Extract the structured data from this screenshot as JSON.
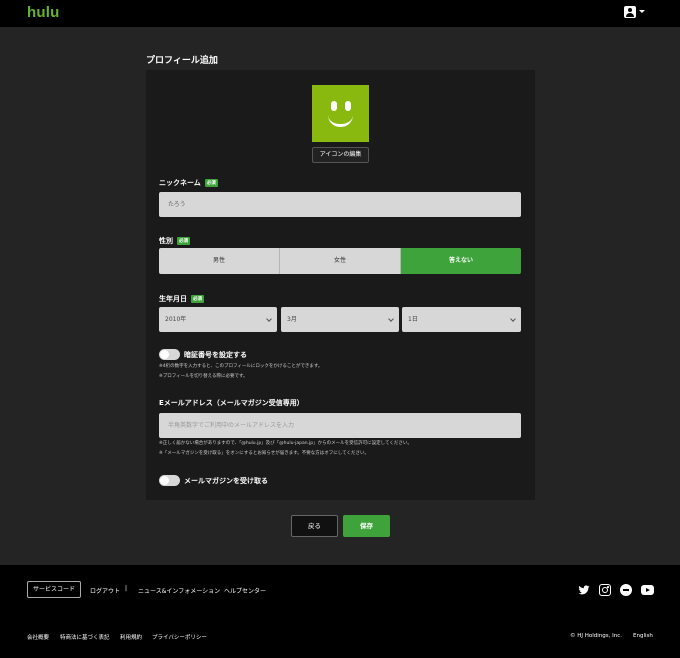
{
  "header": {
    "logo": "hulu"
  },
  "page": {
    "title": "プロフィール追加"
  },
  "avatar": {
    "edit_label": "アイコンの編集",
    "color": "#89b90f"
  },
  "required_badge": "必須",
  "nickname": {
    "label": "ニックネーム",
    "value": "たろう"
  },
  "gender": {
    "label": "性別",
    "options": [
      "男性",
      "女性",
      "答えない"
    ],
    "selected": "答えない"
  },
  "birthday": {
    "label": "生年月日",
    "year": "2010年",
    "month": "3月",
    "day": "1日"
  },
  "pin": {
    "label": "暗証番号を設定する",
    "note1": "※4桁の数字を入力すると、このプロフィールにロックをかけることができます。",
    "note2": "※プロフィールを切り替える際に必要です。"
  },
  "email": {
    "label": "Eメールアドレス（メールマガジン受信専用）",
    "placeholder": "半角英数字でご利用中のメールアドレスを入力",
    "note1": "※正しく届かない場合がありますので、「@hulu.jp」及び「@hulu-japan.jp」からのメールを受信許可に設定してください。",
    "note2": "※「メールマガジンを受け取る」をオンにするとお知らせが届きます。不要な方はオフにしてください。"
  },
  "newsletter": {
    "label": "メールマガジンを受け取る"
  },
  "actions": {
    "back": "戻る",
    "save": "保存"
  },
  "footer": {
    "service_code": "サービスコード",
    "logout": "ログアウト",
    "separator": "|",
    "news": "ニュース&インフォメーション",
    "help": "ヘルプセンター",
    "company": "会社概要",
    "law": "特商法に基づく表記",
    "terms": "利用規約",
    "privacy": "プライバシーポリシー",
    "copyright": "© HJ Holdings, Inc.",
    "language": "English"
  },
  "colors": {
    "accent": "#3da33a",
    "brand": "#66b32e",
    "background": "#242424"
  }
}
